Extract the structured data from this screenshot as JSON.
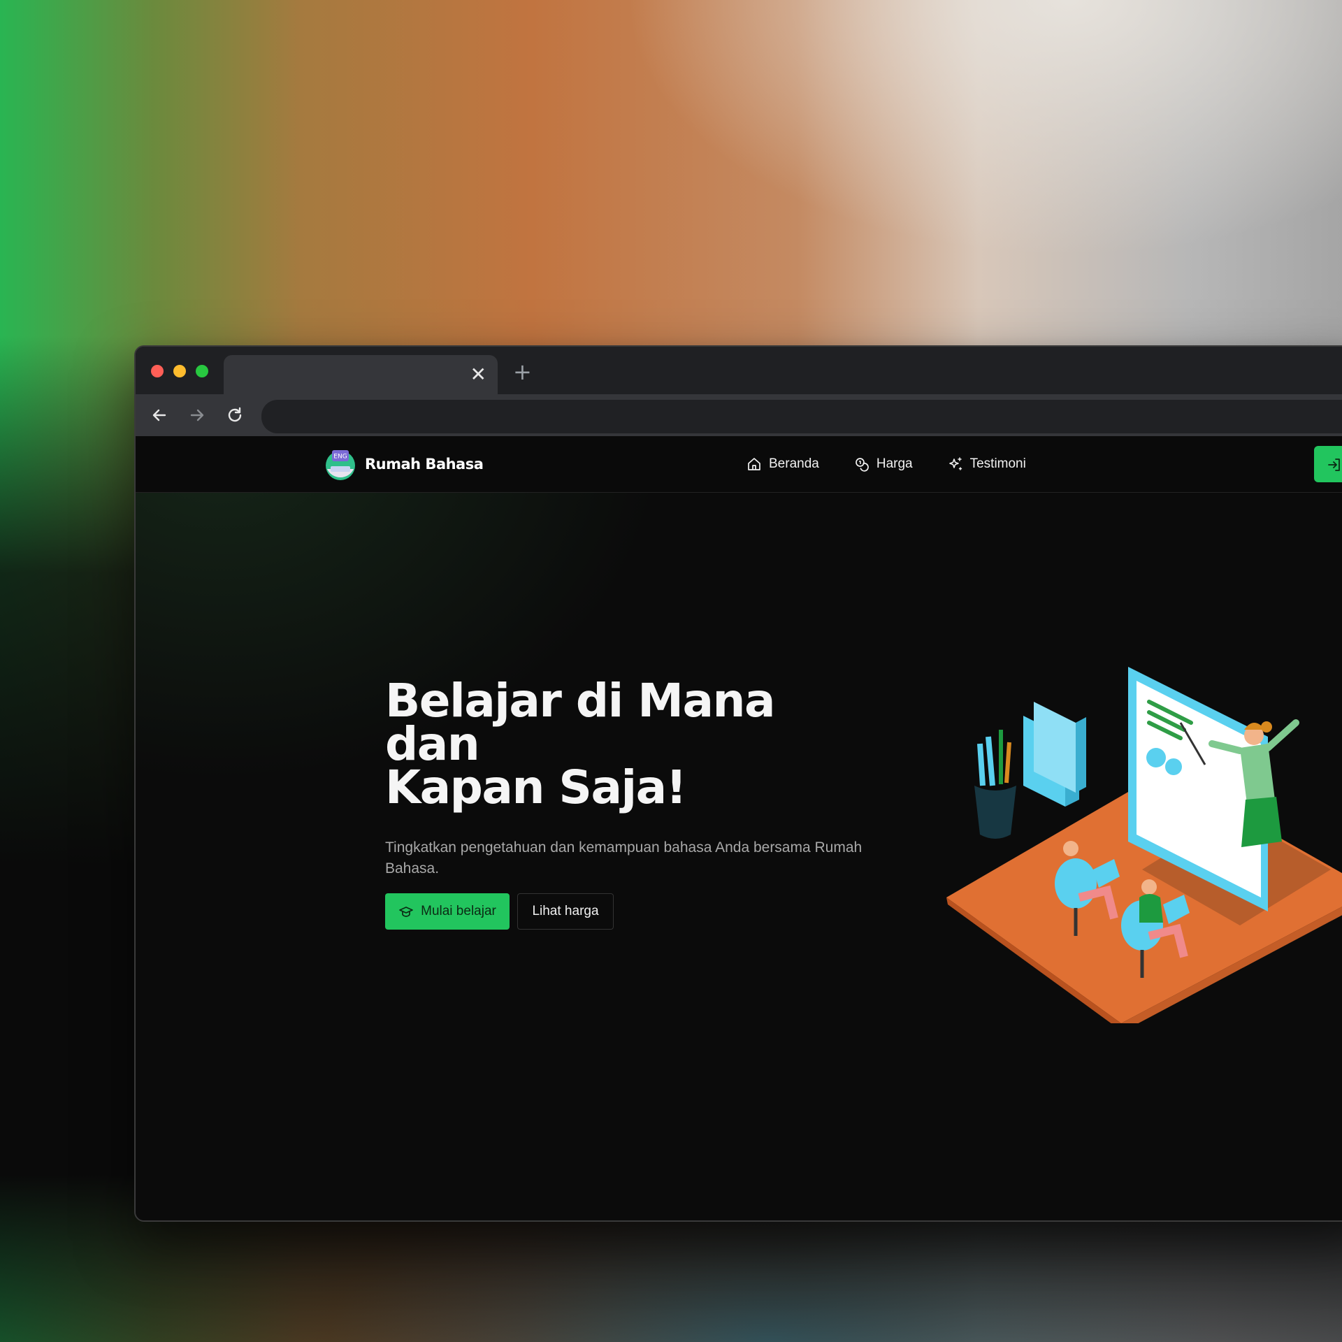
{
  "browser": {
    "tab_title": "",
    "tab_close_glyph": "✕",
    "new_tab_glyph": "+",
    "address_value": ""
  },
  "site": {
    "brand_name": "Rumah Bahasa",
    "logo_badge": "ENG",
    "nav": {
      "items": [
        {
          "label": "Beranda",
          "icon": "home-icon"
        },
        {
          "label": "Harga",
          "icon": "coins-icon"
        },
        {
          "label": "Testimoni",
          "icon": "sparkles-icon"
        }
      ],
      "login_icon": "login-icon"
    },
    "hero": {
      "title_line1": "Belajar di Mana dan",
      "title_line2": "Kapan Saja!",
      "subtitle": "Tingkatkan pengetahuan dan kemampuan bahasa Anda bersama Rumah Bahasa.",
      "primary_button": "Mulai belajar",
      "secondary_button": "Lihat harga"
    }
  },
  "colors": {
    "accent": "#22c55e",
    "page_background": "#0b0b0b",
    "chrome_tabbar": "#1f2023",
    "chrome_toolbar": "#35363a"
  }
}
